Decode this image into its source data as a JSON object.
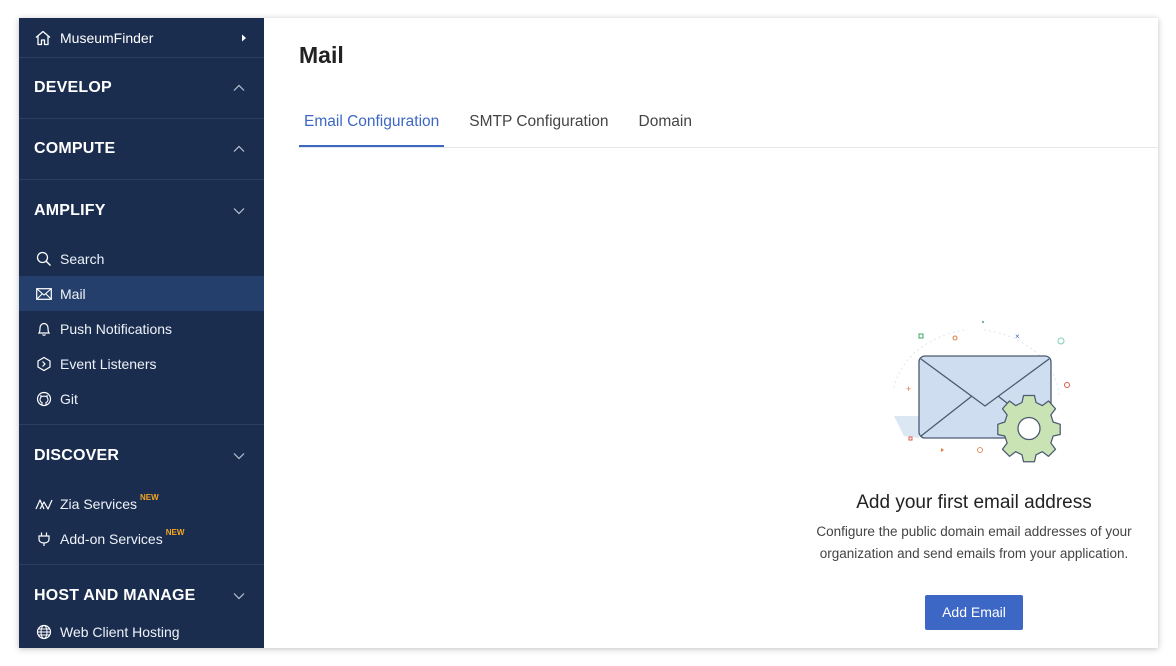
{
  "sidebar": {
    "project_name": "MuseumFinder",
    "sections": {
      "develop": "DEVELOP",
      "compute": "COMPUTE",
      "amplify": "AMPLIFY",
      "discover": "DISCOVER",
      "host": "HOST AND MANAGE"
    },
    "amplify_items": [
      "Search",
      "Mail",
      "Push Notifications",
      "Event Listeners",
      "Git"
    ],
    "discover_items": [
      "Zia Services",
      "Add-on Services"
    ],
    "new_badge": "NEW",
    "host_items": [
      "Web Client Hosting"
    ],
    "active_item": "Mail"
  },
  "main": {
    "title": "Mail",
    "tabs": [
      "Email Configuration",
      "SMTP Configuration",
      "Domain"
    ],
    "active_tab": "Email Configuration",
    "empty_state": {
      "title": "Add your first email address",
      "description_line1": "Configure the public domain email addresses of your",
      "description_line2": "organization and send emails from your application.",
      "button": "Add Email"
    }
  },
  "colors": {
    "sidebar_bg": "#1b2d4f",
    "sidebar_active": "#243f6b",
    "accent": "#3d67c5",
    "badge": "#f5a623"
  }
}
